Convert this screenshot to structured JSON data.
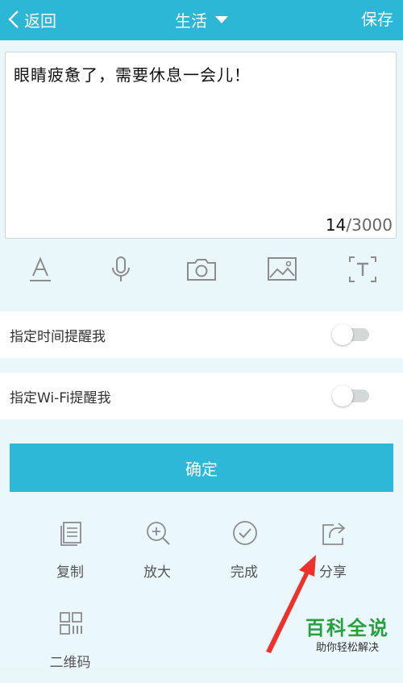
{
  "header": {
    "back_label": "返回",
    "title": "生活",
    "save_label": "保存"
  },
  "editor": {
    "text": "眼睛疲惫了，需要休息一会儿！",
    "count": "14",
    "max": "/3000"
  },
  "toolbar": {
    "tools": [
      "text-format-icon",
      "microphone-icon",
      "camera-icon",
      "image-icon",
      "text-box-icon"
    ]
  },
  "reminders": [
    {
      "label": "指定时间提醒我",
      "enabled": false
    },
    {
      "label": "指定Wi-Fi提醒我",
      "enabled": false
    }
  ],
  "confirm_label": "确定",
  "share_menu": {
    "items": [
      {
        "label": "复制",
        "icon": "copy-icon"
      },
      {
        "label": "放大",
        "icon": "zoom-in-icon"
      },
      {
        "label": "完成",
        "icon": "check-circle-icon"
      },
      {
        "label": "分享",
        "icon": "share-icon"
      },
      {
        "label": "二维码",
        "icon": "qr-code-icon"
      }
    ]
  },
  "watermark": {
    "title": "百科全说",
    "subtitle": "助你轻松解决"
  },
  "colors": {
    "accent": "#2cb7d6",
    "annotation_arrow": "#f0302a",
    "watermark_green": "#27a03e"
  }
}
